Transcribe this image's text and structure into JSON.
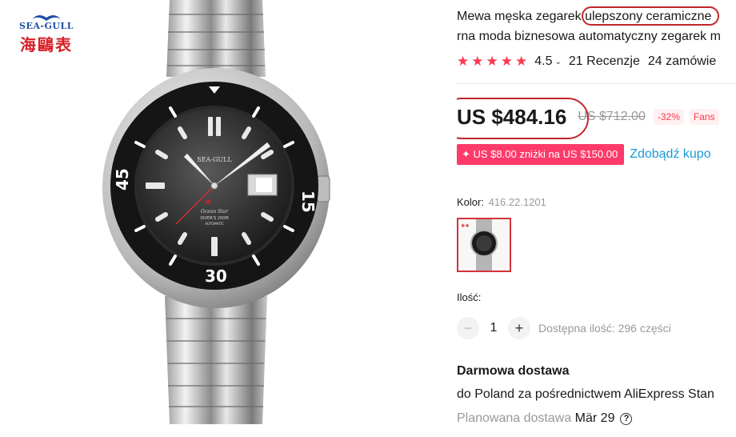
{
  "brand": {
    "logo_text": "SEA-GULL",
    "logo_chinese": "海鷗表"
  },
  "product": {
    "title_before": "Mewa męska zegarek ",
    "title_highlight": "ulepszony ceramiczne",
    "title_line2": "rna moda biznesowa automatyczny zegarek m",
    "dial_brand": "SEA-GULL",
    "dial_model": "Ocean Star",
    "dial_depth": "DIVER'S 200M",
    "dial_type": "AUTOMATIC",
    "bezel_15": "15",
    "bezel_45": "45",
    "bezel_30": "30"
  },
  "rating": {
    "value": "4.5",
    "stars": 5,
    "reviews": "21 Recenzje",
    "orders": "24 zamówie"
  },
  "price": {
    "current": "US $484.16",
    "original": "US $712.00",
    "discount": "-32%",
    "fans_badge": "Fans"
  },
  "coupon": {
    "label": "US $8.00 zniżki na US $150.00",
    "link": "Zdobądź kupo"
  },
  "variant": {
    "label": "Kolor:",
    "value": "416.22.1201"
  },
  "quantity": {
    "label": "Ilość:",
    "value": "1",
    "minus": "−",
    "plus": "+",
    "stock": "Dostępna ilość: 296 części"
  },
  "shipping": {
    "title": "Darmowa dostawa",
    "line": "do Poland za pośrednictwem AliExpress Stan",
    "planned_label": "Planowana dostawa",
    "planned_date": "Mär 29"
  },
  "colors": {
    "accent": "#fd384f",
    "link": "#1a9bd7",
    "annotation": "#c0262b"
  }
}
